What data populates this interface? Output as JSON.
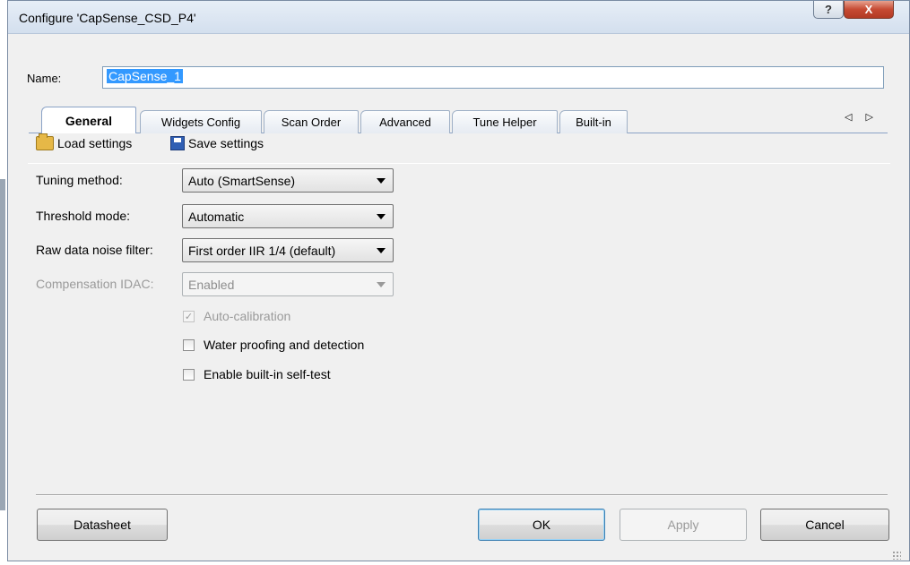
{
  "window": {
    "title": "Configure 'CapSense_CSD_P4'",
    "help_label": "?",
    "close_label": "X"
  },
  "name_field": {
    "label": "Name:",
    "value": "CapSense_1"
  },
  "tabs": [
    {
      "label": "General"
    },
    {
      "label": "Widgets Config"
    },
    {
      "label": "Scan Order"
    },
    {
      "label": "Advanced"
    },
    {
      "label": "Tune Helper"
    },
    {
      "label": "Built-in"
    }
  ],
  "tab_scroll_arrows": "◁ ▷",
  "toolbar": {
    "load_label": "Load settings",
    "save_label": "Save settings"
  },
  "settings": {
    "tuning_method": {
      "label": "Tuning method:",
      "value": "Auto (SmartSense)"
    },
    "threshold_mode": {
      "label": "Threshold mode:",
      "value": "Automatic"
    },
    "raw_filter": {
      "label": "Raw data noise filter:",
      "value": "First order IIR 1/4 (default)"
    },
    "comp_idac": {
      "label": "Compensation IDAC:",
      "value": "Enabled"
    }
  },
  "checkboxes": {
    "auto_calibration": {
      "label": "Auto-calibration",
      "checked": true,
      "disabled": true,
      "mark": "✓"
    },
    "water_proofing": {
      "label": "Water proofing and detection",
      "checked": false
    },
    "self_test": {
      "label": "Enable built-in self-test",
      "checked": false
    }
  },
  "buttons": {
    "datasheet": "Datasheet",
    "ok": "OK",
    "apply": "Apply",
    "cancel": "Cancel"
  },
  "colors": {
    "titlebar": "#d3dfee",
    "close": "#c64a33",
    "selection": "#3399ff",
    "tab_border": "#8aa2c6"
  }
}
